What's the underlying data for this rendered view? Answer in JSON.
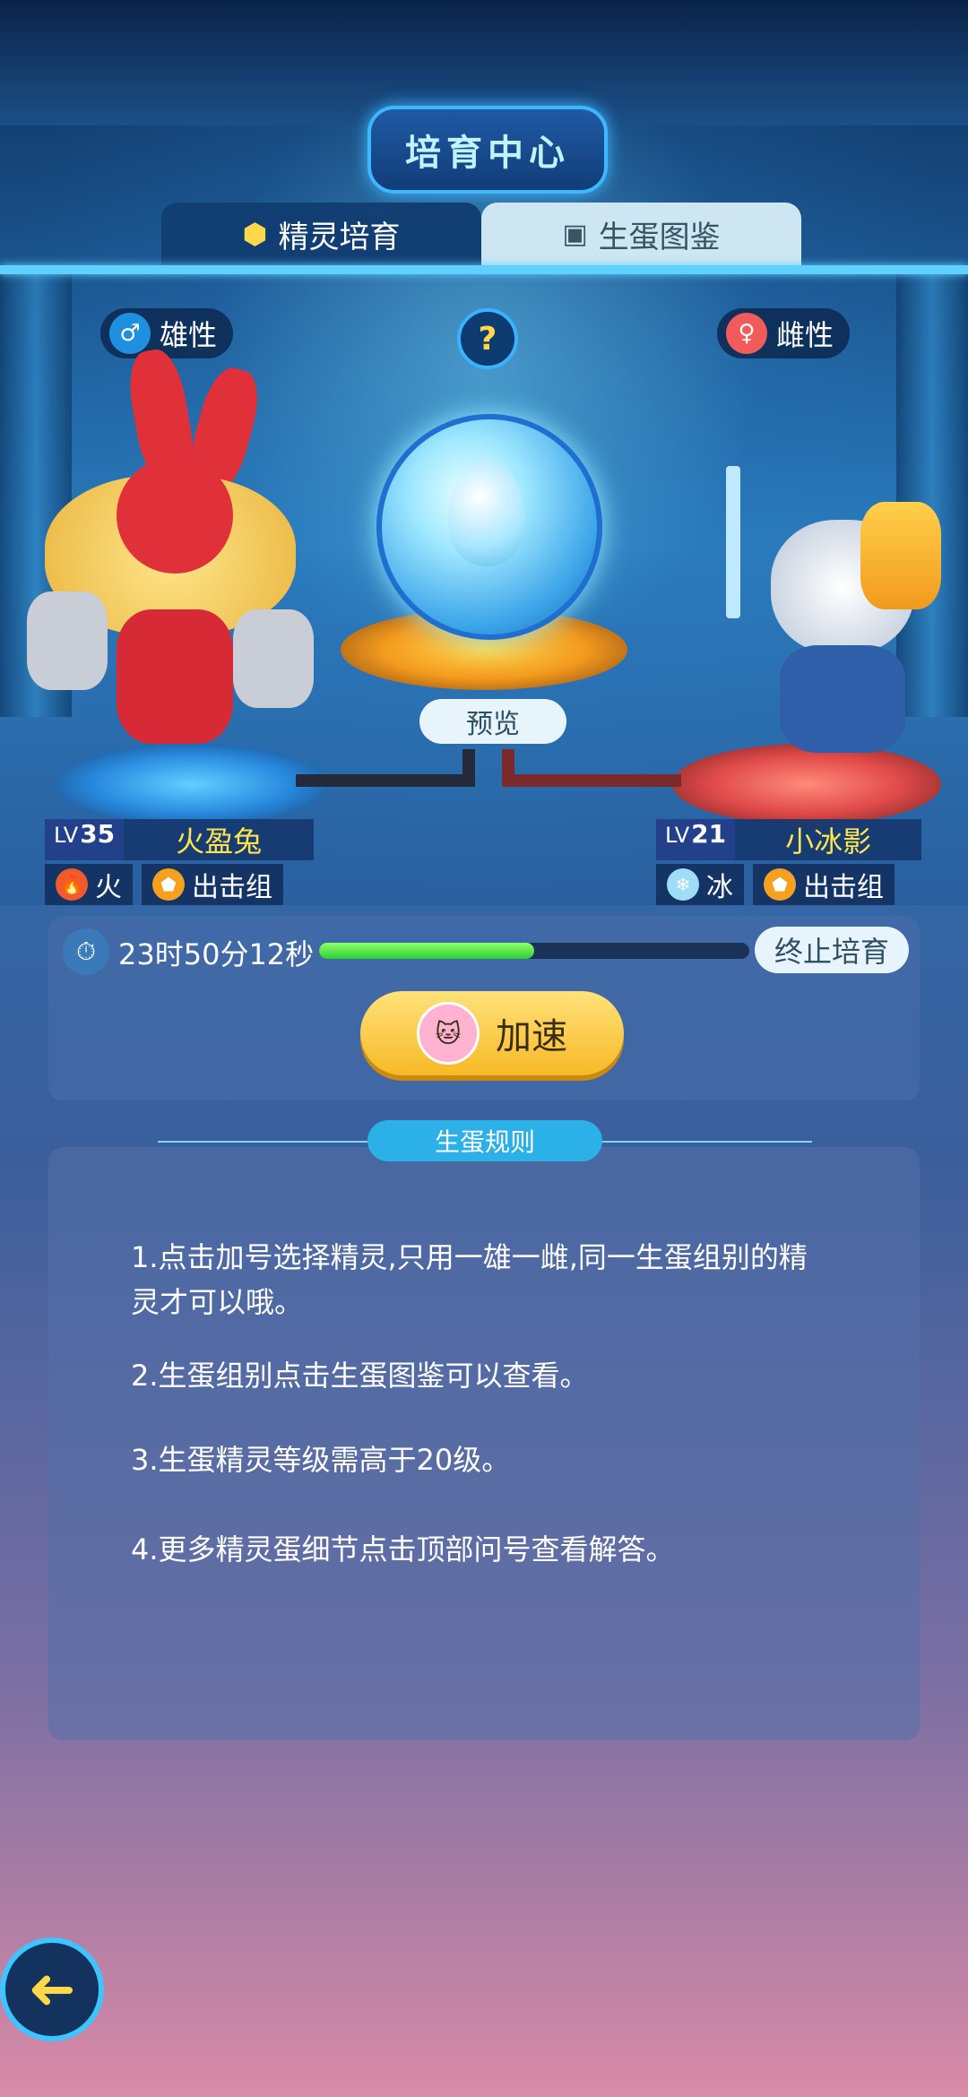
{
  "header": {
    "title": "培育中心",
    "tabs": [
      {
        "label": "精灵培育",
        "icon": "hexagon-icon",
        "active": true
      },
      {
        "label": "生蛋图鉴",
        "icon": "book-icon",
        "active": false
      }
    ]
  },
  "breeding": {
    "male_label": "雄性",
    "female_label": "雌性",
    "help_symbol": "?",
    "preview_label": "预览"
  },
  "left_pet": {
    "lv_prefix": "LV",
    "level": "35",
    "name": "火盈兔",
    "element": "火",
    "group": "出击组"
  },
  "right_pet": {
    "lv_prefix": "LV",
    "level": "21",
    "name": "小冰影",
    "element": "冰",
    "group": "出击组"
  },
  "progress": {
    "time": "23时50分12秒",
    "fraction": 0.5,
    "stop_label": "终止培育",
    "speed_label": "加速"
  },
  "rules": {
    "title": "生蛋规则",
    "items": [
      "1.点击加号选择精灵,只用一雄一雌,同一生蛋组别的精灵才可以哦。",
      "2.生蛋组别点击生蛋图鉴可以查看。",
      "3.生蛋精灵等级需高于20级。",
      "4.更多精灵蛋细节点击顶部问号查看解答。"
    ]
  },
  "colors": {
    "accent": "#3fb7ff",
    "progress": "#2fcf35",
    "speed_button": "#f7b926",
    "name_text": "#ffe34d"
  }
}
